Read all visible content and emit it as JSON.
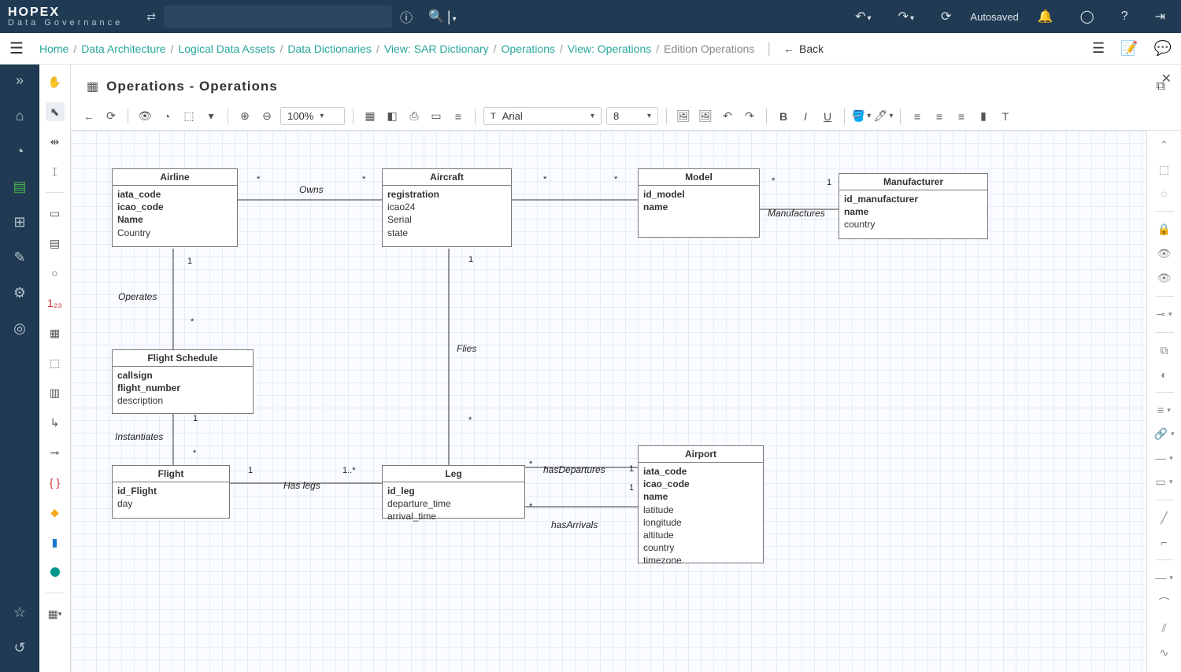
{
  "app": {
    "name": "HOPEX",
    "subtitle": "Data Governance"
  },
  "topbar": {
    "autosaved": "Autosaved"
  },
  "breadcrumb": {
    "items": [
      "Home",
      "Data Architecture",
      "Logical Data Assets",
      "Data Dictionaries",
      "View: SAR Dictionary",
      "Operations",
      "View: Operations"
    ],
    "current": "Edition Operations",
    "back": "Back"
  },
  "page": {
    "title": "Operations - Operations"
  },
  "toolbar": {
    "zoom": "100%",
    "font": "Arial",
    "fontSize": "8"
  },
  "entities": {
    "airline": {
      "title": "Airline",
      "attrs": [
        {
          "n": "iata_code",
          "b": true
        },
        {
          "n": "icao_code",
          "b": true
        },
        {
          "n": "Name",
          "b": true
        },
        {
          "n": "Country",
          "b": false
        }
      ]
    },
    "aircraft": {
      "title": "Aircraft",
      "attrs": [
        {
          "n": "registration",
          "b": true
        },
        {
          "n": "icao24",
          "b": false
        },
        {
          "n": "Serial",
          "b": false
        },
        {
          "n": "state",
          "b": false
        }
      ]
    },
    "model": {
      "title": "Model",
      "attrs": [
        {
          "n": "id_model",
          "b": true
        },
        {
          "n": "name",
          "b": true
        }
      ]
    },
    "manufacturer": {
      "title": "Manufacturer",
      "attrs": [
        {
          "n": "id_manufacturer",
          "b": true
        },
        {
          "n": "name",
          "b": true
        },
        {
          "n": "country",
          "b": false
        }
      ]
    },
    "flight_schedule": {
      "title": "Flight Schedule",
      "attrs": [
        {
          "n": "callsign",
          "b": true
        },
        {
          "n": "flight_number",
          "b": true
        },
        {
          "n": "description",
          "b": false
        }
      ]
    },
    "flight": {
      "title": "Flight",
      "attrs": [
        {
          "n": "id_Flight",
          "b": true
        },
        {
          "n": "day",
          "b": false
        }
      ]
    },
    "leg": {
      "title": "Leg",
      "attrs": [
        {
          "n": "id_leg",
          "b": true
        },
        {
          "n": "departure_time",
          "b": false
        },
        {
          "n": "arrival_time",
          "b": false
        }
      ]
    },
    "airport": {
      "title": "Airport",
      "attrs": [
        {
          "n": "iata_code",
          "b": true
        },
        {
          "n": "icao_code",
          "b": true
        },
        {
          "n": "name",
          "b": true
        },
        {
          "n": "latitude",
          "b": false
        },
        {
          "n": "longitude",
          "b": false
        },
        {
          "n": "altitude",
          "b": false
        },
        {
          "n": "country",
          "b": false
        },
        {
          "n": "timezone",
          "b": false
        }
      ]
    }
  },
  "relationships": {
    "owns": "Owns",
    "operates": "Operates",
    "manufactures": "Manufactures",
    "flies": "Flies",
    "instantiates": "Instantiates",
    "has_legs": "Has legs",
    "has_departures": "hasDepartures",
    "has_arrivals": "hasArrivals"
  },
  "card": {
    "one": "1",
    "star": "*",
    "one_star": "1..*"
  }
}
